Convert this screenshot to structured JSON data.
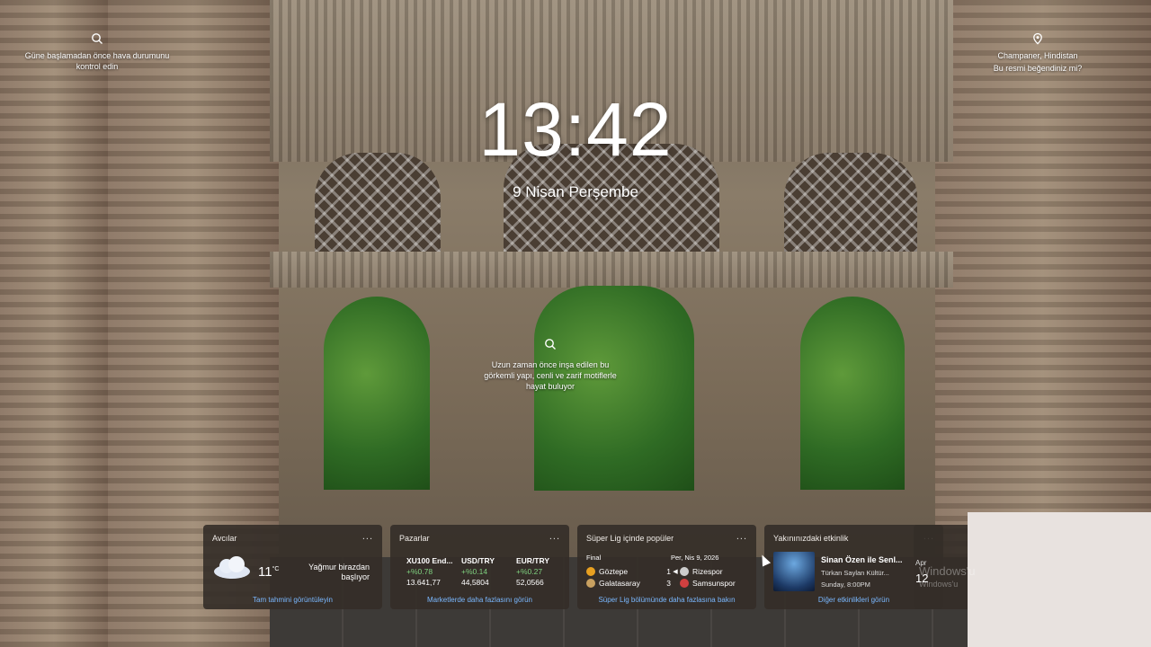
{
  "top_left_hint": {
    "text": "Güne başlamadan önce hava durumunu kontrol edin",
    "icon": "search-icon"
  },
  "top_right_hint": {
    "location": "Champaner, Hindistan",
    "question": "Bu resmi beğendiniz mi?",
    "icon": "location-pin-icon"
  },
  "clock": {
    "time": "13:42",
    "date": "9 Nisan Perşembe"
  },
  "center_hint": {
    "text": "Uzun zaman önce inşa edilen bu görkemli yapı, cenli ve zarif motiflerle hayat buluyor",
    "icon": "search-icon"
  },
  "widgets": {
    "weather": {
      "title": "Avcılar",
      "more": "...",
      "temp": "11",
      "unit": "°C",
      "desc_line1": "Yağmur birazdan",
      "desc_line2": "başlıyor",
      "link": "Tam tahmini görüntüleyin",
      "icon": "cloud-icon"
    },
    "markets": {
      "title": "Pazarlar",
      "more": "...",
      "items": [
        {
          "name": "XU100 End...",
          "change": "+%0.78",
          "value": "13.641,77"
        },
        {
          "name": "USD/TRY",
          "change": "+%0.14",
          "value": "44,5804"
        },
        {
          "name": "EUR/TRY",
          "change": "+%0.27",
          "value": "52,0566"
        }
      ],
      "link": "Marketlerde daha fazlasını görün"
    },
    "football": {
      "title": "Süper Lig içinde popüler",
      "more": "...",
      "status": "Final",
      "date": "Per, Nis 9, 2026",
      "home": [
        {
          "team": "Göztepe",
          "score": "1",
          "color": "#e8a020"
        },
        {
          "team": "Galatasaray",
          "score": "3",
          "color": "#c8a060"
        }
      ],
      "away": [
        {
          "team": "Rizespor",
          "color": "#cccccc"
        },
        {
          "team": "Samsunspor",
          "color": "#d04040"
        }
      ],
      "link": "Süper Lig bölümünde daha fazlasına bakın"
    },
    "events": {
      "title": "Yakınınızdaki etkinlik",
      "more": "...",
      "event_title": "Sinan Özen ile Senl...",
      "venue": "Türkan Saylan Kültür...",
      "time": "Sunday, 8:00PM",
      "link": "Diğer etkinlikleri görün"
    },
    "partial": {
      "month": "Apr",
      "day": "12"
    }
  },
  "watermark": {
    "line1": "Windows'u",
    "line2": "Windows'u"
  }
}
